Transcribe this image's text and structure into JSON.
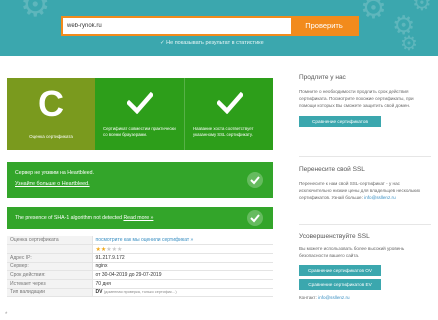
{
  "header": {
    "search_value": "web-rynok.ru",
    "search_button": "Проверить",
    "hide_results_label": "Не показывать результат в статистике",
    "check_icon": "check-icon",
    "gear_icon": "gear-icon"
  },
  "grade": {
    "letter": "C",
    "label": "Оценка сертификата"
  },
  "checks": [
    {
      "icon": "check-icon",
      "text": "Сертификат совместим практически со всеми браузерами."
    },
    {
      "icon": "check-icon",
      "text": "Название хоста соответствует указанному SSL сертификату."
    }
  ],
  "heartbleed": {
    "title": "Сервер не уязвим на Heartbleed.",
    "link": "Узнайте больше о Heartbleed."
  },
  "sha1": {
    "title": "The presence of SHA-1 algorithm not detected",
    "link": "Read more »"
  },
  "table": [
    {
      "label": "Оценка сертификата",
      "value": "посмотрите как мы оценили сертификат »",
      "type": "link"
    },
    {
      "label": "",
      "value": "",
      "type": "stars",
      "rating": 2,
      "max": 5
    },
    {
      "label": "Адрес IP:",
      "value": "91.217.9.172",
      "type": "text"
    },
    {
      "label": "Сервер:",
      "value": "nginx",
      "type": "text"
    },
    {
      "label": "Срок действия:",
      "value": "от 30-04-2019 до 29-07-2019",
      "type": "text"
    },
    {
      "label": "Истекает через",
      "value": "70 дня",
      "type": "text"
    },
    {
      "label": "Тип валидации",
      "value": "DV",
      "note": "(доменная проверка, только сертифик…)",
      "type": "dv"
    }
  ],
  "sidebar": {
    "extend": {
      "title": "Продлите у нас",
      "text": "Помните о необходимости продлить срок действия сертификата. Посмотрите похожие сертификаты, при помощи которых Вы сможете защитить свой домен.",
      "button": "Сравнение сертификатов"
    },
    "transfer": {
      "title": "Перенесите свой SSL",
      "text": "Перенесите к нам свой SSL-сертификат - у нас исключительно низкие цены для владельцев нескольких сертификатов.",
      "contact_prefix": "Узнай больше:",
      "contact_email": "info@ssllenz.ru",
      "button": "Сравнение сертификатов"
    },
    "upgrade": {
      "title": "Усовершенствуйте SSL",
      "text": "Вы можете использовать более высокий уровень безопасности вашего сайта.",
      "button_ov": "Сравнение сертификатов OV",
      "button_ev": "Сравнение сертификатов EV",
      "contact_prefix": "Контакт:",
      "contact_email": "info@ssllenz.ru"
    }
  },
  "footer_mark": "*"
}
